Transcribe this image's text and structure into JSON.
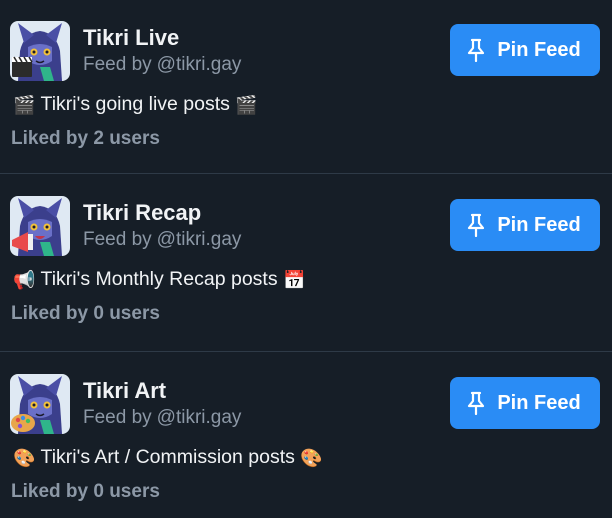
{
  "feeds": [
    {
      "title": "Tikri Live",
      "byline_prefix": "Feed by",
      "handle": "@tikri.gay",
      "description": "Tikri's going live posts",
      "desc_emoji_start": "🎬",
      "desc_emoji_end": "🎬",
      "likes": "Liked by 2 users",
      "pin_label": "Pin Feed",
      "avatar_icon": "clapperboard-icon"
    },
    {
      "title": "Tikri Recap",
      "byline_prefix": "Feed by",
      "handle": "@tikri.gay",
      "description": "Tikri's Monthly Recap posts",
      "desc_emoji_start": "📢",
      "desc_emoji_end": "📅",
      "likes": "Liked by 0 users",
      "pin_label": "Pin Feed",
      "avatar_icon": "megaphone-icon"
    },
    {
      "title": "Tikri Art",
      "byline_prefix": "Feed by",
      "handle": "@tikri.gay",
      "description": "Tikri's Art / Commission posts",
      "desc_emoji_start": "🎨",
      "desc_emoji_end": "🎨",
      "likes": "Liked by 0 users",
      "pin_label": "Pin Feed",
      "avatar_icon": "palette-icon"
    }
  ],
  "colors": {
    "background": "#161e27",
    "divider": "#2e3a47",
    "primary_text": "#f1f3f5",
    "secondary_text": "#8c98a6",
    "button": "#2a8cf5"
  }
}
